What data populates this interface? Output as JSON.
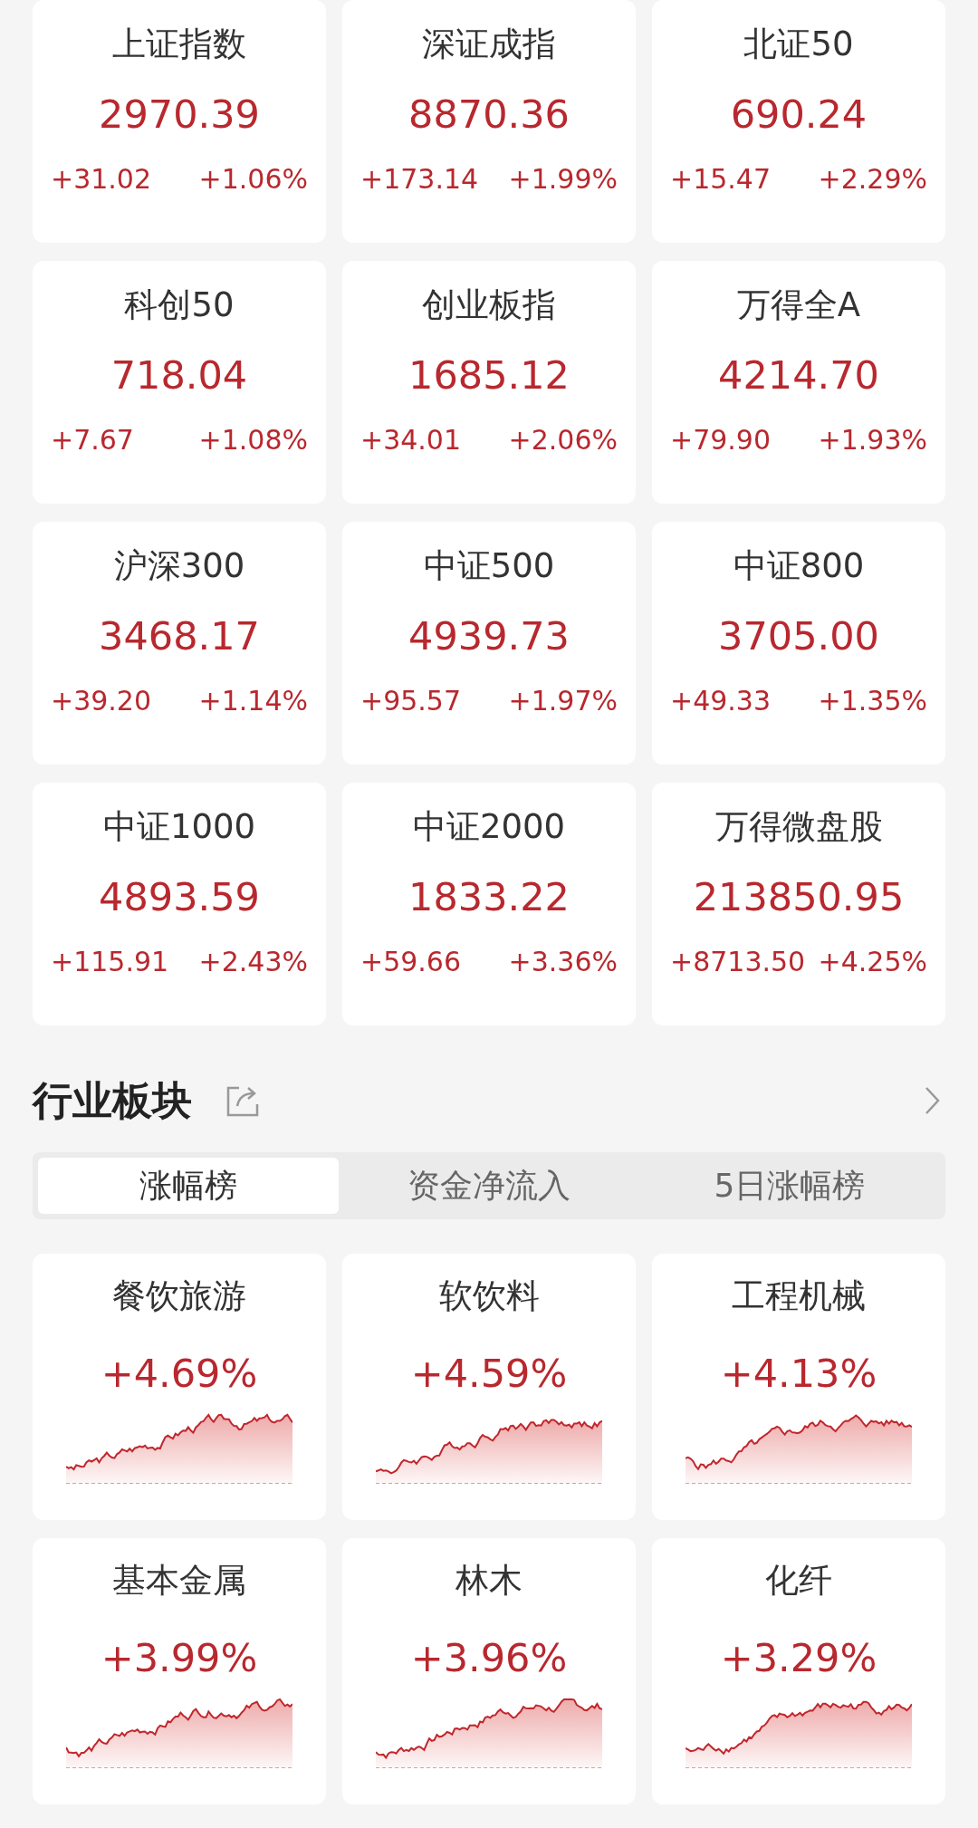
{
  "indices": [
    {
      "name": "上证指数",
      "price": "2970.39",
      "change": "+31.02",
      "percent": "+1.06%"
    },
    {
      "name": "深证成指",
      "price": "8870.36",
      "change": "+173.14",
      "percent": "+1.99%"
    },
    {
      "name": "北证50",
      "price": "690.24",
      "change": "+15.47",
      "percent": "+2.29%"
    },
    {
      "name": "科创50",
      "price": "718.04",
      "change": "+7.67",
      "percent": "+1.08%"
    },
    {
      "name": "创业板指",
      "price": "1685.12",
      "change": "+34.01",
      "percent": "+2.06%"
    },
    {
      "name": "万得全A",
      "price": "4214.70",
      "change": "+79.90",
      "percent": "+1.93%"
    },
    {
      "name": "沪深300",
      "price": "3468.17",
      "change": "+39.20",
      "percent": "+1.14%"
    },
    {
      "name": "中证500",
      "price": "4939.73",
      "change": "+95.57",
      "percent": "+1.97%"
    },
    {
      "name": "中证800",
      "price": "3705.00",
      "change": "+49.33",
      "percent": "+1.35%"
    },
    {
      "name": "中证1000",
      "price": "4893.59",
      "change": "+115.91",
      "percent": "+2.43%"
    },
    {
      "name": "中证2000",
      "price": "1833.22",
      "change": "+59.66",
      "percent": "+3.36%"
    },
    {
      "name": "万得微盘股",
      "price": "213850.95",
      "change": "+8713.50",
      "percent": "+4.25%"
    }
  ],
  "sector_section": {
    "title": "行业板块",
    "tabs": [
      {
        "label": "涨幅榜",
        "selected": true
      },
      {
        "label": "资金净流入",
        "selected": false
      },
      {
        "label": "5日涨幅榜",
        "selected": false
      }
    ],
    "sectors": [
      {
        "name": "餐饮旅游",
        "percent": "+4.69%"
      },
      {
        "name": "软饮料",
        "percent": "+4.59%"
      },
      {
        "name": "工程机械",
        "percent": "+4.13%"
      },
      {
        "name": "基本金属",
        "percent": "+3.99%"
      },
      {
        "name": "林木",
        "percent": "+3.96%"
      },
      {
        "name": "化纤",
        "percent": "+3.29%"
      }
    ]
  }
}
